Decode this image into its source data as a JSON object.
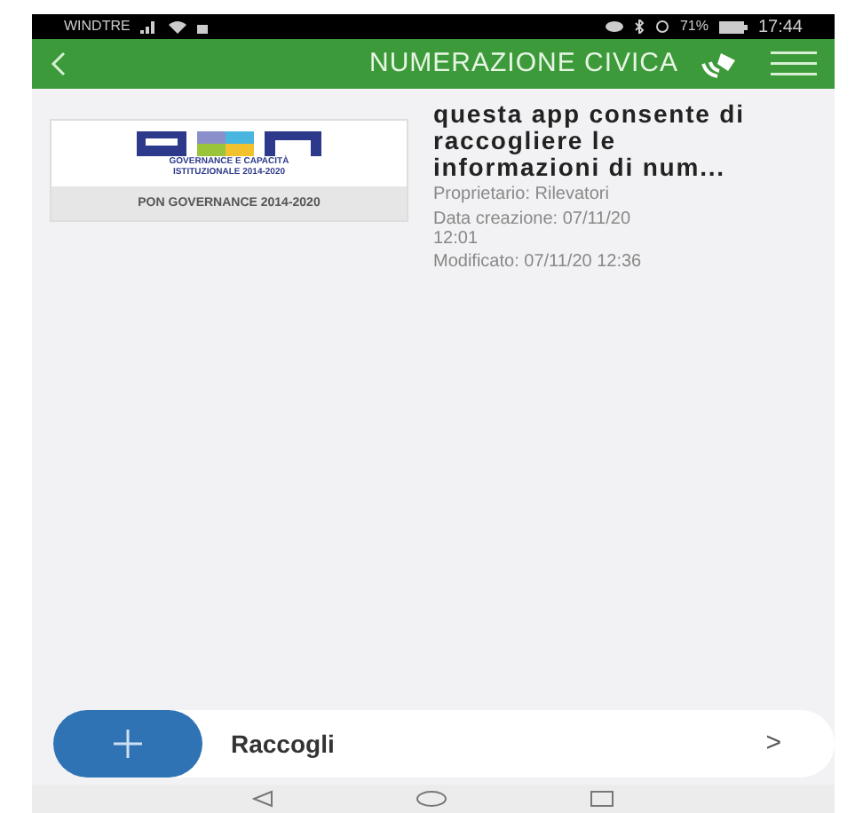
{
  "status_bar": {
    "carrier": "WINDTRE",
    "battery_percent": "71%",
    "time": "17:44"
  },
  "header": {
    "title": "NUMERAZIONE CIVICA"
  },
  "item": {
    "logo_caption": "GOVERNANCE E CAPACITÀ ISTITUZIONALE 2014-2020",
    "logo_label": "PON GOVERNANCE 2014-2020",
    "title": "questa app consente di raccogliere le informazioni di num...",
    "owner": "Proprietario: Rilevatori",
    "created": "Data creazione: 07/11/20 12:01",
    "modified": "Modificato: 07/11/20 12:36"
  },
  "action": {
    "label": "Raccogli",
    "chevron": ">"
  }
}
